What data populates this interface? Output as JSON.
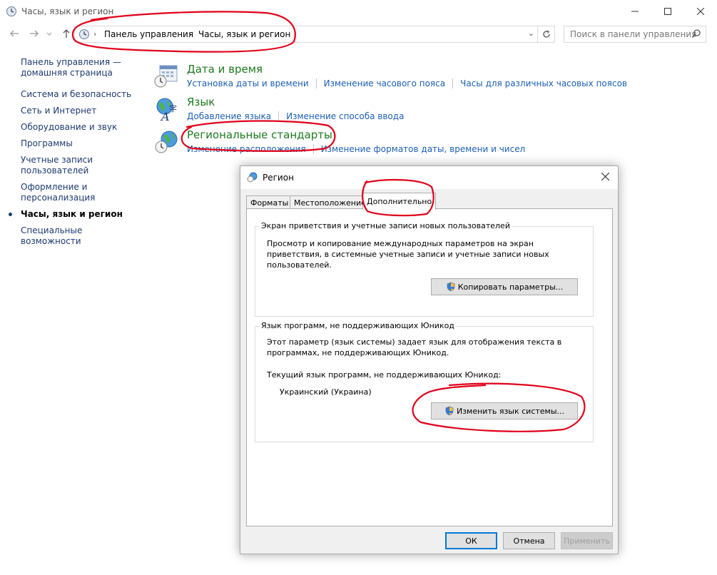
{
  "window": {
    "title": "Часы, язык и регион"
  },
  "address": {
    "crumbs": [
      "Панель управления",
      "Часы, язык и регион"
    ],
    "search_placeholder": "Поиск в панели управления"
  },
  "sidebar": {
    "items": [
      {
        "label": "Панель управления — домашняя страница"
      },
      {
        "label": "Система и безопасность"
      },
      {
        "label": "Сеть и Интернет"
      },
      {
        "label": "Оборудование и звук"
      },
      {
        "label": "Программы"
      },
      {
        "label": "Учетные записи пользователей"
      },
      {
        "label": "Оформление и персонализация"
      },
      {
        "label": "Часы, язык и регион"
      },
      {
        "label": "Специальные возможности"
      }
    ]
  },
  "categories": [
    {
      "title": "Дата и время",
      "links": [
        "Установка даты и времени",
        "Изменение часового пояса",
        "Часы для различных часовых поясов"
      ]
    },
    {
      "title": "Язык",
      "links": [
        "Добавление языка",
        "Изменение способа ввода"
      ]
    },
    {
      "title": "Региональные стандарты",
      "links": [
        "Изменение расположения",
        "Изменение форматов даты, времени и чисел"
      ]
    }
  ],
  "dialog": {
    "title": "Регион",
    "tabs": [
      "Форматы",
      "Местоположение",
      "Дополнительно"
    ],
    "active_tab": "Дополнительно",
    "welcome_group": {
      "label": "Экран приветствия и учетные записи новых пользователей",
      "text": "Просмотр и копирование международных параметров на экран приветствия, в системные учетные записи и учетные записи новых пользователей.",
      "button": "Копировать параметры..."
    },
    "unicode_group": {
      "label": "Язык программ, не поддерживающих Юникод",
      "text": "Этот параметр (язык системы) задает язык для отображения текста в программах, не поддерживающих Юникод.",
      "current_label": "Текущий язык программ, не поддерживающих Юникод:",
      "current_value": "Украинский (Украина)",
      "button": "Изменить язык системы..."
    },
    "ok": "ОК",
    "cancel": "Отмена",
    "apply": "Применить"
  },
  "colors": {
    "link": "#1c5fb3",
    "category_title": "#1e7a1e",
    "annotation": "#e0001a",
    "focus": "#0078d7"
  }
}
